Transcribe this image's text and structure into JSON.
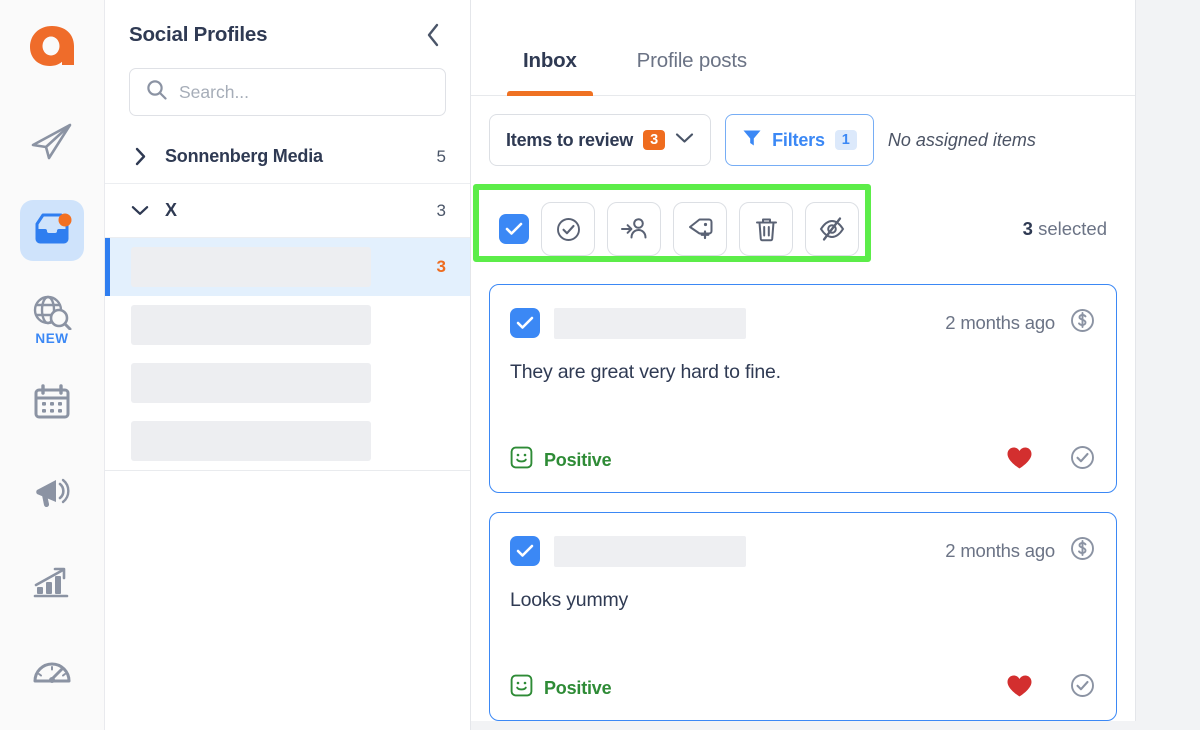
{
  "brand": {
    "logo_letter": "a",
    "accent_orange": "#ef6c1e",
    "accent_blue": "#3b88f5",
    "highlight_green": "#5ced49"
  },
  "rail": {
    "items": [
      {
        "name": "logo",
        "icon": "agorapulse-logo",
        "label": ""
      },
      {
        "name": "publishing",
        "icon": "paper-plane-icon",
        "label": ""
      },
      {
        "name": "inbox",
        "icon": "inbox-icon",
        "label": "",
        "active": true,
        "has_dot": true
      },
      {
        "name": "listening",
        "icon": "globe-search-icon",
        "label": "NEW"
      },
      {
        "name": "calendar",
        "icon": "calendar-icon",
        "label": ""
      },
      {
        "name": "campaigns",
        "icon": "megaphone-icon",
        "label": ""
      },
      {
        "name": "reports",
        "icon": "growth-chart-icon",
        "label": ""
      },
      {
        "name": "dashboard",
        "icon": "gauge-icon",
        "label": ""
      }
    ]
  },
  "profiles": {
    "title": "Social Profiles",
    "collapse_icon": "chevron-left-icon",
    "search": {
      "placeholder": "Search...",
      "value": "",
      "icon": "search-icon"
    },
    "groups": [
      {
        "name": "Sonnenberg Media",
        "count": "5",
        "expanded": false,
        "chevron": "chevron-right-icon"
      },
      {
        "name": "X",
        "count": "3",
        "expanded": true,
        "chevron": "chevron-down-icon"
      }
    ],
    "rows": [
      {
        "name": "profile-row-selected",
        "count": "3",
        "selected": true
      },
      {
        "name": "profile-row-2",
        "count": "",
        "selected": false
      },
      {
        "name": "profile-row-3",
        "count": "",
        "selected": false
      },
      {
        "name": "profile-row-4",
        "count": "",
        "selected": false
      }
    ]
  },
  "main": {
    "tabs": [
      {
        "label": "Inbox",
        "active": true
      },
      {
        "label": "Profile posts",
        "active": false
      }
    ],
    "filter_bar": {
      "items_to_review": {
        "label": "Items to review",
        "badge": "3",
        "chevron": "chevron-down-icon"
      },
      "filters": {
        "label": "Filters",
        "badge": "1",
        "icon": "funnel-icon"
      },
      "no_assigned": "No assigned items"
    },
    "action_bar": {
      "select_all_checked": true,
      "buttons": [
        {
          "name": "mark-reviewed-button",
          "icon": "check-circle-icon"
        },
        {
          "name": "assign-user-button",
          "icon": "assign-user-icon"
        },
        {
          "name": "add-tag-button",
          "icon": "tag-plus-icon"
        },
        {
          "name": "delete-button",
          "icon": "trash-icon"
        },
        {
          "name": "hide-button",
          "icon": "eye-slash-icon"
        }
      ],
      "selected_count": "3",
      "selected_label": "selected"
    },
    "cards": [
      {
        "checked": true,
        "author_redacted": true,
        "time": "2 months ago",
        "money_icon": "dollar-circle-icon",
        "text": "They are great very hard to fine.",
        "sentiment": "Positive",
        "sentiment_icon": "smiley-icon",
        "like_icon": "heart-icon",
        "review_icon": "check-circle-icon"
      },
      {
        "checked": true,
        "author_redacted": true,
        "time": "2 months ago",
        "money_icon": "dollar-circle-icon",
        "text": "Looks yummy",
        "sentiment": "Positive",
        "sentiment_icon": "smiley-icon",
        "like_icon": "heart-icon",
        "review_icon": "check-circle-icon"
      }
    ]
  }
}
